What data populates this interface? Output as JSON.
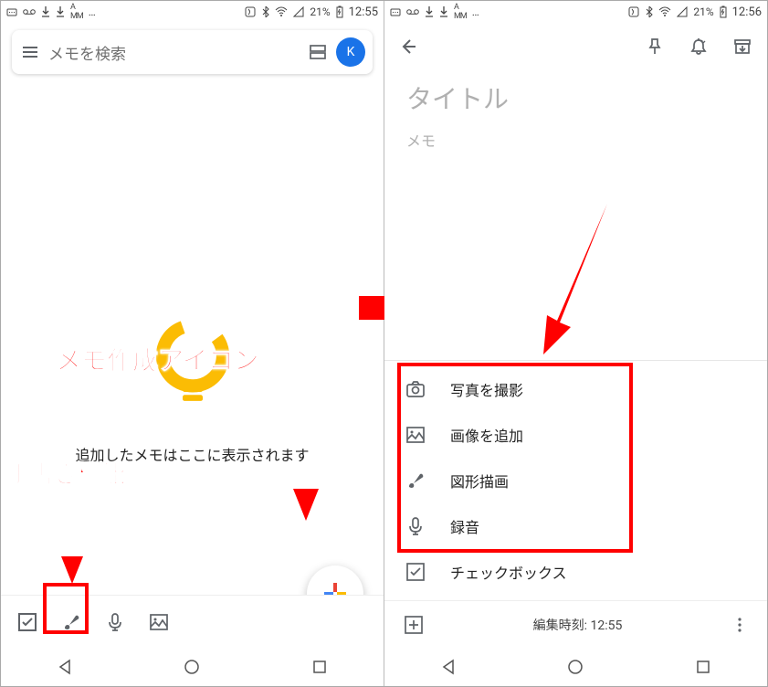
{
  "left": {
    "status": {
      "battery": "21%",
      "time": "12:55"
    },
    "search": {
      "placeholder": "メモを検索",
      "avatar": "K"
    },
    "empty_message": "追加したメモはここに表示されます"
  },
  "right": {
    "status": {
      "battery": "21%",
      "time": "12:56"
    },
    "note": {
      "title_placeholder": "タイトル",
      "body_placeholder": "メモ"
    },
    "menu": {
      "take_photo": "写真を撮影",
      "add_image": "画像を追加",
      "drawing": "図形描画",
      "record": "録音",
      "checkbox": "チェックボックス"
    },
    "footer": {
      "edit_time": "編集時刻: 12:55"
    }
  },
  "annotations": {
    "create_icon": "メモ作成アイコン",
    "handwriting": "手書き機能"
  }
}
